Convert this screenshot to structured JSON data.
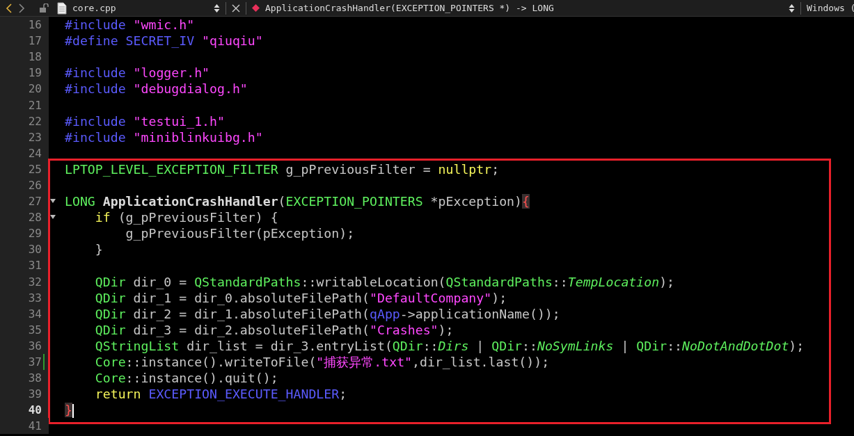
{
  "navigator": {
    "back": {
      "disabled": false
    },
    "forward": {
      "disabled": true
    },
    "file": "core.cpp",
    "symbol": "ApplicationCrashHandler(EXCEPTION_POINTERS *) -> LONG",
    "platform": "Windows ("
  },
  "editor": {
    "lines_before": [
      {
        "number": "16",
        "current": false,
        "modified": false,
        "tokens": [
          {
            "kind": "preproc",
            "text": "#include"
          },
          {
            "kind": "string",
            "text": " \"wmic.h\""
          }
        ]
      },
      {
        "number": "17",
        "current": false,
        "modified": false,
        "tokens": [
          {
            "kind": "preproc",
            "text": "#define"
          },
          {
            "kind": "macro",
            "text": " SECRET_IV"
          },
          {
            "kind": "string",
            "text": " \"qiuqiu\""
          }
        ]
      },
      {
        "number": "18",
        "current": false,
        "modified": false
      },
      {
        "number": "19",
        "current": false,
        "modified": false,
        "tokens": [
          {
            "kind": "preproc",
            "text": "#include"
          },
          {
            "kind": "string",
            "text": " \"logger.h\""
          }
        ]
      },
      {
        "number": "20",
        "current": false,
        "modified": false,
        "tokens": [
          {
            "kind": "preproc",
            "text": "#include"
          },
          {
            "kind": "string",
            "text": " \"debugdialog.h\""
          }
        ]
      },
      {
        "number": "21",
        "current": false,
        "modified": false
      },
      {
        "number": "22",
        "current": false,
        "modified": false,
        "tokens": [
          {
            "kind": "preproc",
            "text": "#include"
          },
          {
            "kind": "string",
            "text": " \"testui_1.h\""
          }
        ]
      },
      {
        "number": "23",
        "current": false,
        "modified": false,
        "tokens": [
          {
            "kind": "preproc",
            "text": "#include"
          },
          {
            "kind": "string",
            "text": " \"miniblinkuibg.h\""
          }
        ]
      },
      {
        "number": "24",
        "current": false,
        "modified": false
      }
    ],
    "highlighted_block": [
      {
        "number": "25",
        "current": false,
        "modified": false,
        "tokens": [
          {
            "kind": "type",
            "text": "LPTOP_LEVEL_EXCEPTION_FILTER"
          },
          {
            "kind": "plain",
            "text": " g_pPreviousFilter = "
          },
          {
            "kind": "keyword",
            "text": "nullptr"
          },
          {
            "kind": "plain",
            "text": ";"
          }
        ]
      },
      {
        "number": "26",
        "current": false,
        "modified": false
      },
      {
        "number": "27",
        "current": false,
        "modified": false,
        "expanded": true,
        "tokens": [
          {
            "kind": "type",
            "text": "LONG"
          },
          {
            "kind": "function",
            "text": " ApplicationCrashHandler"
          },
          {
            "kind": "plain",
            "text": "("
          },
          {
            "kind": "type",
            "text": "EXCEPTION_POINTERS"
          },
          {
            "kind": "plain",
            "text": " *pException)"
          },
          {
            "kind": "brace",
            "text": "{"
          }
        ]
      },
      {
        "number": "28",
        "current": false,
        "modified": false,
        "expanded": true,
        "tokens": [
          {
            "kind": "keyword",
            "text": "    if"
          },
          {
            "kind": "plain",
            "text": " (g_pPreviousFilter) {"
          }
        ]
      },
      {
        "number": "29",
        "current": false,
        "modified": false,
        "tokens": [
          {
            "kind": "plain",
            "text": "        g_pPreviousFilter(pException);"
          }
        ]
      },
      {
        "number": "30",
        "current": false,
        "modified": false,
        "tokens": [
          {
            "kind": "plain",
            "text": "    }"
          }
        ]
      },
      {
        "number": "31",
        "current": false,
        "modified": false
      },
      {
        "number": "32",
        "current": false,
        "modified": false,
        "tokens": [
          {
            "kind": "type",
            "text": "    QDir"
          },
          {
            "kind": "plain",
            "text": " dir_0 = "
          },
          {
            "kind": "type",
            "text": "QStandardPaths"
          },
          {
            "kind": "plain",
            "text": "::writableLocation("
          },
          {
            "kind": "type",
            "text": "QStandardPaths"
          },
          {
            "kind": "plain",
            "text": "::"
          },
          {
            "kind": "enum",
            "text": "TempLocation"
          },
          {
            "kind": "plain",
            "text": ");"
          }
        ]
      },
      {
        "number": "33",
        "current": false,
        "modified": false,
        "tokens": [
          {
            "kind": "type",
            "text": "    QDir"
          },
          {
            "kind": "plain",
            "text": " dir_1 = dir_0.absoluteFilePath("
          },
          {
            "kind": "string",
            "text": "\"DefaultCompany\""
          },
          {
            "kind": "plain",
            "text": ");"
          }
        ]
      },
      {
        "number": "34",
        "current": false,
        "modified": false,
        "tokens": [
          {
            "kind": "type",
            "text": "    QDir"
          },
          {
            "kind": "plain",
            "text": " dir_2 = dir_1.absoluteFilePath("
          },
          {
            "kind": "macro",
            "text": "qApp"
          },
          {
            "kind": "plain",
            "text": "->applicationName());"
          }
        ]
      },
      {
        "number": "35",
        "current": false,
        "modified": false,
        "tokens": [
          {
            "kind": "type",
            "text": "    QDir"
          },
          {
            "kind": "plain",
            "text": " dir_3 = dir_2.absoluteFilePath("
          },
          {
            "kind": "string",
            "text": "\"Crashes\""
          },
          {
            "kind": "plain",
            "text": ");"
          }
        ]
      },
      {
        "number": "36",
        "current": false,
        "modified": false,
        "tokens": [
          {
            "kind": "type",
            "text": "    QStringList"
          },
          {
            "kind": "plain",
            "text": " dir_list = dir_3.entryList("
          },
          {
            "kind": "type",
            "text": "QDir"
          },
          {
            "kind": "plain",
            "text": "::"
          },
          {
            "kind": "enum",
            "text": "Dirs"
          },
          {
            "kind": "plain",
            "text": " | "
          },
          {
            "kind": "type",
            "text": "QDir"
          },
          {
            "kind": "plain",
            "text": "::"
          },
          {
            "kind": "enum",
            "text": "NoSymLinks"
          },
          {
            "kind": "plain",
            "text": " | "
          },
          {
            "kind": "type",
            "text": "QDir"
          },
          {
            "kind": "plain",
            "text": "::"
          },
          {
            "kind": "enum",
            "text": "NoDotAndDotDot"
          },
          {
            "kind": "plain",
            "text": ");"
          }
        ]
      },
      {
        "number": "37",
        "current": false,
        "modified": true,
        "tokens": [
          {
            "kind": "type",
            "text": "    Core"
          },
          {
            "kind": "plain",
            "text": "::instance().writeToFile("
          },
          {
            "kind": "string",
            "text": "\"捕获异常.txt\""
          },
          {
            "kind": "plain",
            "text": ",dir_list.last());"
          }
        ]
      },
      {
        "number": "38",
        "current": false,
        "modified": false,
        "tokens": [
          {
            "kind": "type",
            "text": "    Core"
          },
          {
            "kind": "plain",
            "text": "::instance().quit();"
          }
        ]
      },
      {
        "number": "39",
        "current": false,
        "modified": false,
        "tokens": [
          {
            "kind": "keyword",
            "text": "    return"
          },
          {
            "kind": "macro",
            "text": " EXCEPTION_EXECUTE_HANDLER"
          },
          {
            "kind": "plain",
            "text": ";"
          }
        ]
      },
      {
        "number": "40",
        "current": true,
        "modified": false,
        "tokens": [
          {
            "kind": "brace",
            "text": "}"
          }
        ]
      }
    ],
    "lines_after": [
      {
        "number": "41",
        "current": false,
        "modified": false
      }
    ]
  }
}
